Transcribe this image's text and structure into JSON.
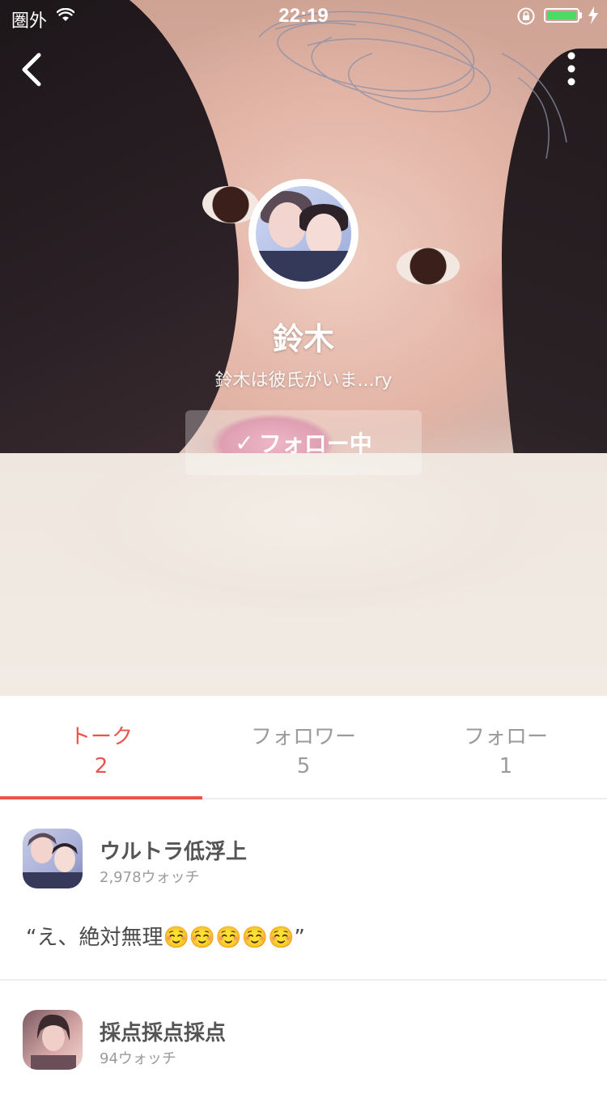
{
  "status_bar": {
    "carrier": "圏外",
    "time": "22:19"
  },
  "profile": {
    "name": "鈴木",
    "bio": "鈴木は彼氏がいま...ry",
    "follow_button_label": "フォロー中",
    "follow_check": "✓"
  },
  "tabs": [
    {
      "label": "トーク",
      "count": "2",
      "active": true
    },
    {
      "label": "フォロワー",
      "count": "5",
      "active": false
    },
    {
      "label": "フォロー",
      "count": "1",
      "active": false
    }
  ],
  "posts": [
    {
      "title": "ウルトラ低浮上",
      "meta": "2,978ウォッチ",
      "body": "“え、絶対無理☺️☺️☺️☺️☺️”"
    },
    {
      "title": "採点採点採点",
      "meta": "94ウォッチ",
      "body": ""
    }
  ],
  "colors": {
    "accent": "#e9544b",
    "battery": "#4cd964",
    "muted_text": "#9b9b9b"
  },
  "icons": {
    "back": "chevron-left-icon",
    "more": "more-vertical-icon",
    "wifi": "wifi-icon",
    "orientation_lock": "rotation-lock-icon",
    "charging": "charging-bolt-icon",
    "check": "checkmark-icon"
  }
}
